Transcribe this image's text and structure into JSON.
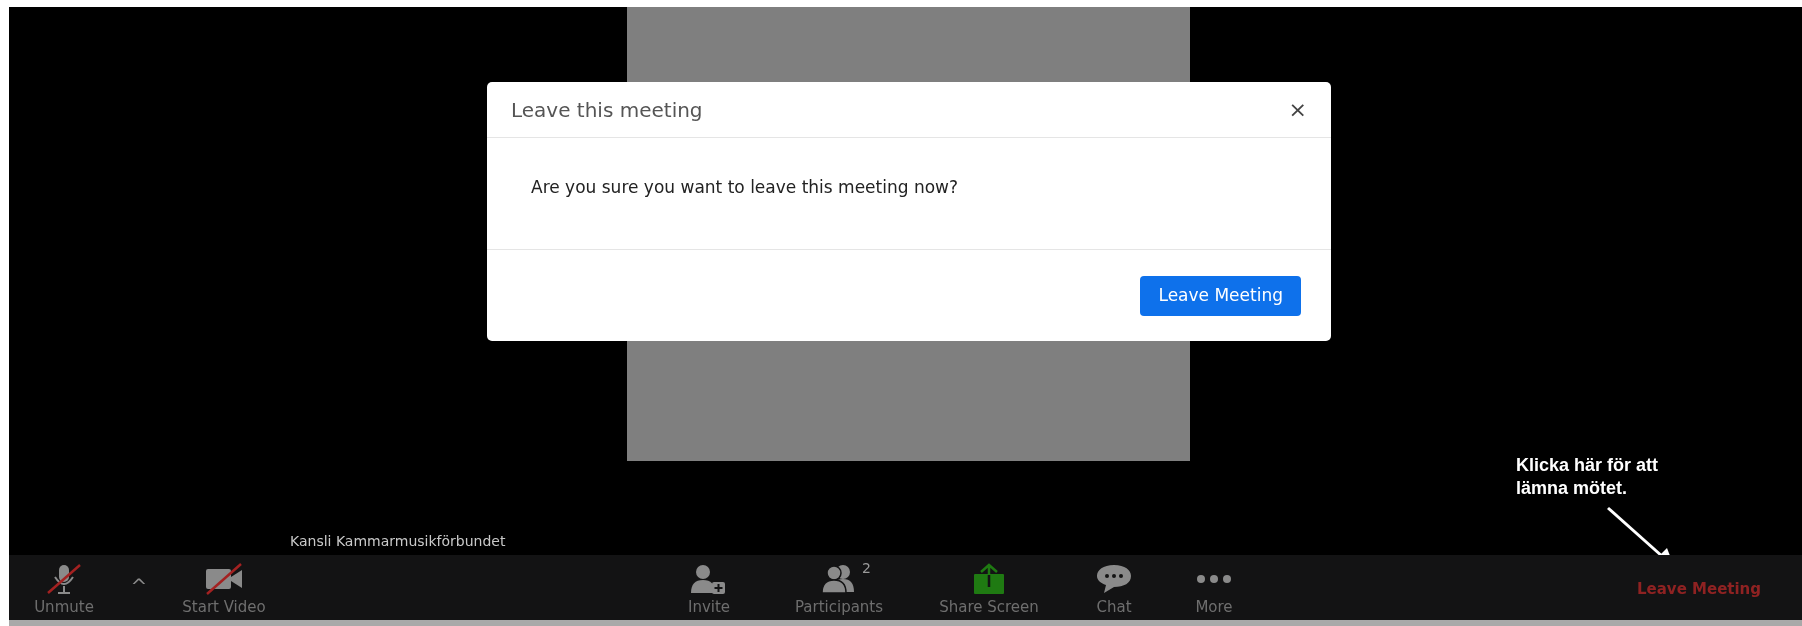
{
  "participant_name": "Kansli Kammarmusikförbundet",
  "toolbar": {
    "items": [
      {
        "kind": "mic",
        "label": "Unmute",
        "off": true
      },
      {
        "kind": "caret",
        "label": "^"
      },
      {
        "kind": "video",
        "label": "Start Video",
        "off": true
      },
      {
        "kind": "invite",
        "label": "Invite"
      },
      {
        "kind": "participants",
        "label": "Participants",
        "count": "2"
      },
      {
        "kind": "share",
        "label": "Share Screen"
      },
      {
        "kind": "chat",
        "label": "Chat"
      },
      {
        "kind": "more",
        "label": "More"
      }
    ],
    "leave_label": "Leave Meeting"
  },
  "dialog": {
    "title": "Leave this meeting",
    "close": "×",
    "message": "Are you sure you want to leave this meeting now?",
    "button": "Leave Meeting"
  },
  "annotation": {
    "text": "Klicka här för att lämna mötet."
  }
}
